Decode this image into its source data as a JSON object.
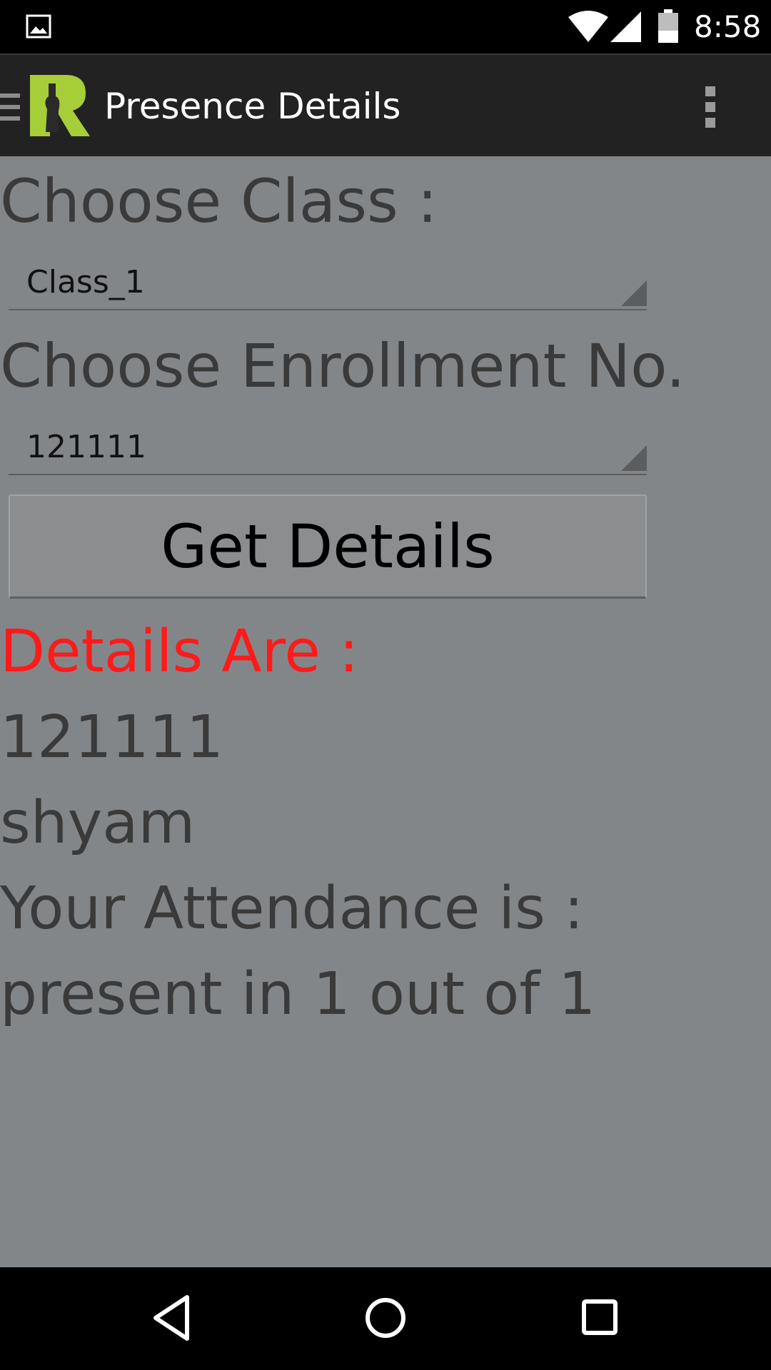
{
  "status_bar": {
    "time": "8:58",
    "icons": [
      "image-notification-icon",
      "wifi-icon",
      "cell-signal-icon",
      "battery-icon"
    ]
  },
  "action_bar": {
    "title": "Presence Details",
    "logo_color": "#a6ce39",
    "icons": [
      "drawer-icon",
      "app-logo",
      "overflow-menu-icon"
    ]
  },
  "form": {
    "class_label": "Choose Class :",
    "class_value": "Class_1",
    "enrollment_label": "Choose Enrollment No.",
    "enrollment_value": "121111",
    "button_label": "Get Details"
  },
  "details": {
    "heading": "Details Are :",
    "heading_color": "#ff1a1a",
    "enrollment": "121111",
    "name": "shyam",
    "attendance_label": "Your Attendance is :",
    "attendance_value": "present in 1 out of 1"
  },
  "nav_bar": {
    "icons": [
      "back-icon",
      "home-icon",
      "recents-icon"
    ]
  }
}
